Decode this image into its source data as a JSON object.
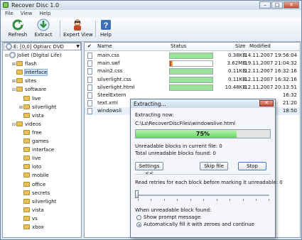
{
  "window": {
    "title": "Recover Disc 1.0",
    "btn_min": "–",
    "btn_max": "□",
    "btn_close": "✕"
  },
  "menu": [
    "File",
    "View",
    "Help"
  ],
  "toolbar": [
    {
      "label": "Refresh",
      "icon": "refresh-icon"
    },
    {
      "label": "Extract",
      "icon": "extract-icon"
    },
    {
      "label": "Expert View",
      "icon": "expert-icon"
    },
    {
      "label": "Help",
      "icon": "help-icon"
    }
  ],
  "drive": {
    "label": "E: [0,0] Optiarc  DVD",
    "arrow": "▼"
  },
  "tree": [
    {
      "label": "Joliet (Digital Life)",
      "level": 0,
      "exp": "⊟",
      "disc": true
    },
    {
      "label": "flash",
      "level": 1,
      "exp": "⊞"
    },
    {
      "label": "interface",
      "level": 1,
      "exp": "",
      "selected": true
    },
    {
      "label": "sites",
      "level": 1,
      "exp": "⊞"
    },
    {
      "label": "software",
      "level": 1,
      "exp": "⊟"
    },
    {
      "label": "live",
      "level": 2,
      "exp": ""
    },
    {
      "label": "silverlight",
      "level": 2,
      "exp": "⊞"
    },
    {
      "label": "vista",
      "level": 2,
      "exp": ""
    },
    {
      "label": "videos",
      "level": 1,
      "exp": "⊟"
    },
    {
      "label": "free",
      "level": 2,
      "exp": ""
    },
    {
      "label": "games",
      "level": 2,
      "exp": ""
    },
    {
      "label": "interface",
      "level": 2,
      "exp": ""
    },
    {
      "label": "live",
      "level": 2,
      "exp": ""
    },
    {
      "label": "loto",
      "level": 2,
      "exp": ""
    },
    {
      "label": "mobile",
      "level": 2,
      "exp": ""
    },
    {
      "label": "office",
      "level": 2,
      "exp": ""
    },
    {
      "label": "secrets",
      "level": 2,
      "exp": ""
    },
    {
      "label": "silverlight",
      "level": 2,
      "exp": ""
    },
    {
      "label": "vista",
      "level": 2,
      "exp": ""
    },
    {
      "label": "vs",
      "level": 2,
      "exp": ""
    },
    {
      "label": "xbox",
      "level": 2,
      "exp": ""
    }
  ],
  "list": {
    "headers": {
      "check": "✔",
      "name": "Name",
      "status": "Status",
      "size": "Size",
      "modified": "Modified"
    },
    "rows": [
      {
        "name": "main.css",
        "size": "0.38KB",
        "modified": "14.11.2007 19:56:04",
        "progress": 1.0,
        "bad": false
      },
      {
        "name": "main.swf",
        "size": "3.62MB",
        "modified": "19.11.2007 21:04:32",
        "progress": 0.06,
        "bad": true
      },
      {
        "name": "main2.css",
        "size": "0.11KB",
        "modified": "12.11.2007 16:32:16",
        "progress": 1.0,
        "bad": false
      },
      {
        "name": "silverlight.css",
        "size": "0.11KB",
        "modified": "12.11.2007 16:32:16",
        "progress": 1.0,
        "bad": false
      },
      {
        "name": "silverlight.html",
        "size": "10.48KB",
        "modified": "12.11.2007 20:13:51",
        "progress": 1.0,
        "bad": false
      },
      {
        "name": "SteelExtern",
        "size": "",
        "modified": "16:32",
        "progress": 0,
        "bad": false
      },
      {
        "name": "text.xml",
        "size": "",
        "modified": "21:20",
        "progress": 0,
        "bad": false
      },
      {
        "name": "windowsli",
        "size": "",
        "modified": "18:50",
        "progress": 0,
        "bad": false,
        "selected": true
      }
    ]
  },
  "dialog": {
    "title": "Extracting...",
    "close": "✕",
    "extracting_label": "Extracting now:",
    "path": "C:\\Ls\\RecoverDiscFiles\\windowslive.html",
    "progress": 0.75,
    "progress_text": "75%",
    "unreadable_current": "Unreadable blocks in current file: 0",
    "unreadable_total": "Total unreadable blocks found: 0",
    "btn_settings": "Settings <<",
    "btn_skip": "Skip file",
    "btn_stop": "Stop",
    "retries_label": "Read retries for each block before marking it unreadable: 0",
    "retries_value": 0,
    "when_found_label": "When unreadable block found:",
    "opt_prompt": "Show prompt message",
    "opt_auto": "Automatically fill it with zeroes and continue",
    "selected_option": "auto"
  }
}
